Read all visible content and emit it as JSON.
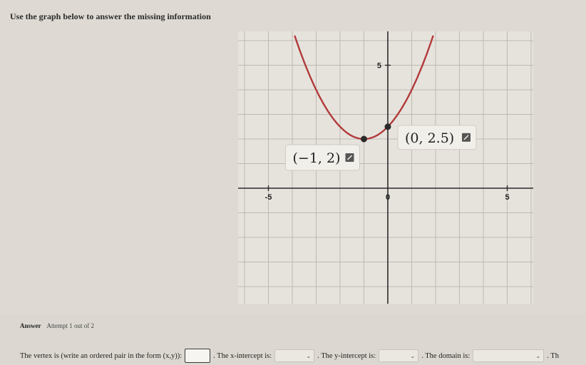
{
  "instruction": "Use the graph below to answer the missing information",
  "graph": {
    "x_ticks": [
      {
        "value": -5,
        "label": "-5"
      },
      {
        "value": 0,
        "label": "0"
      },
      {
        "value": 5,
        "label": "5"
      }
    ],
    "y_ticks": [
      {
        "value": 5,
        "label": "5"
      }
    ],
    "points": [
      {
        "x": -1,
        "y": 2,
        "label": "(−1, 2)"
      },
      {
        "x": 0,
        "y": 2.5,
        "label": "(0, 2.5)"
      }
    ],
    "curve": {
      "a": 0.5,
      "h": -1,
      "k": 2,
      "color": "#b23a3a"
    },
    "point_color": "#2a2a2a"
  },
  "answer": {
    "heading": "Answer",
    "attempt": "Attempt 1 out of 2"
  },
  "question": {
    "part1": "The vertex is (write an ordered pair in the form (x,y)):",
    "part2": ". The x-intercept is:",
    "part3": ". The y-intercept is:",
    "part4": ". The domain is:",
    "part5": ". Th",
    "dropdown_arrow": "⌄"
  }
}
